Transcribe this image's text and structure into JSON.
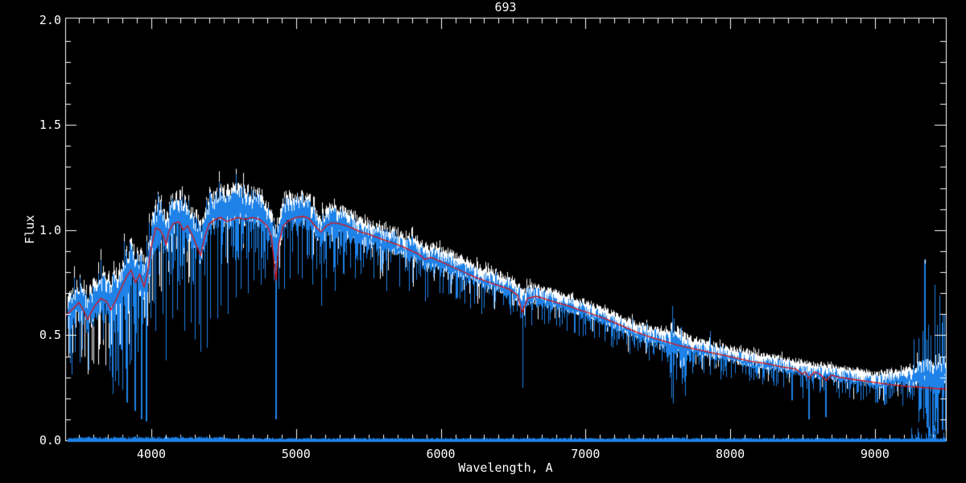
{
  "page": {
    "background_color": "#000000"
  },
  "chart_data": {
    "type": "line",
    "title": "693",
    "xlabel": "Wavelength, A",
    "ylabel": "Flux",
    "xlim": [
      3405,
      9490
    ],
    "ylim": [
      0.0,
      2.0
    ],
    "grid": false,
    "legend": null,
    "background_color": "#000000",
    "axis_color": "#ffffff",
    "x_major_ticks": [
      4000,
      5000,
      6000,
      7000,
      8000,
      9000
    ],
    "x_tick_labels": [
      "4000",
      "5000",
      "6000",
      "7000",
      "8000",
      "9000"
    ],
    "x_minor_step": 100,
    "y_major_ticks": [
      0.0,
      0.5,
      1.0,
      1.5,
      2.0
    ],
    "y_tick_labels": [
      "0.0",
      "0.5",
      "1.0",
      "1.5",
      "2.0"
    ],
    "y_minor_step": 0.1,
    "series": [
      {
        "name": "observed spectrum (white)",
        "type": "noisy-band",
        "color": "#FFFFFF",
        "center_offset": 0.02
      },
      {
        "name": "observed spectrum (blue)",
        "type": "noisy-band",
        "color": "#1E82E8",
        "center_offset": -0.02
      },
      {
        "name": "model fit (red)",
        "type": "line",
        "color": "#DE1212",
        "points": [
          [
            3405,
            0.59
          ],
          [
            3450,
            0.62
          ],
          [
            3500,
            0.655
          ],
          [
            3530,
            0.62
          ],
          [
            3560,
            0.575
          ],
          [
            3600,
            0.63
          ],
          [
            3650,
            0.675
          ],
          [
            3690,
            0.66
          ],
          [
            3720,
            0.62
          ],
          [
            3750,
            0.66
          ],
          [
            3790,
            0.72
          ],
          [
            3830,
            0.78
          ],
          [
            3860,
            0.81
          ],
          [
            3890,
            0.75
          ],
          [
            3920,
            0.79
          ],
          [
            3950,
            0.73
          ],
          [
            3975,
            0.8
          ],
          [
            4000,
            0.92
          ],
          [
            4030,
            1.01
          ],
          [
            4060,
            1.0
          ],
          [
            4085,
            0.97
          ],
          [
            4101,
            0.93
          ],
          [
            4120,
            0.99
          ],
          [
            4150,
            1.03
          ],
          [
            4190,
            1.04
          ],
          [
            4220,
            1.0
          ],
          [
            4250,
            1.02
          ],
          [
            4280,
            0.98
          ],
          [
            4310,
            0.93
          ],
          [
            4340,
            0.88
          ],
          [
            4370,
            0.97
          ],
          [
            4400,
            1.03
          ],
          [
            4440,
            1.05
          ],
          [
            4480,
            1.06
          ],
          [
            4520,
            1.04
          ],
          [
            4560,
            1.05
          ],
          [
            4600,
            1.06
          ],
          [
            4650,
            1.05
          ],
          [
            4700,
            1.06
          ],
          [
            4750,
            1.05
          ],
          [
            4800,
            1.02
          ],
          [
            4830,
            0.97
          ],
          [
            4861,
            0.76
          ],
          [
            4880,
            0.93
          ],
          [
            4910,
            1.02
          ],
          [
            4950,
            1.045
          ],
          [
            5000,
            1.06
          ],
          [
            5050,
            1.065
          ],
          [
            5090,
            1.055
          ],
          [
            5130,
            1.02
          ],
          [
            5172,
            0.99
          ],
          [
            5210,
            1.02
          ],
          [
            5250,
            1.035
          ],
          [
            5300,
            1.03
          ],
          [
            5350,
            1.02
          ],
          [
            5400,
            1.005
          ],
          [
            5450,
            0.99
          ],
          [
            5500,
            0.98
          ],
          [
            5560,
            0.965
          ],
          [
            5620,
            0.95
          ],
          [
            5680,
            0.935
          ],
          [
            5740,
            0.92
          ],
          [
            5800,
            0.9
          ],
          [
            5850,
            0.885
          ],
          [
            5890,
            0.86
          ],
          [
            5930,
            0.87
          ],
          [
            6000,
            0.85
          ],
          [
            6080,
            0.825
          ],
          [
            6160,
            0.8
          ],
          [
            6240,
            0.775
          ],
          [
            6320,
            0.755
          ],
          [
            6400,
            0.735
          ],
          [
            6470,
            0.72
          ],
          [
            6530,
            0.69
          ],
          [
            6563,
            0.61
          ],
          [
            6600,
            0.675
          ],
          [
            6660,
            0.685
          ],
          [
            6730,
            0.67
          ],
          [
            6800,
            0.655
          ],
          [
            6880,
            0.64
          ],
          [
            6960,
            0.62
          ],
          [
            7050,
            0.6
          ],
          [
            7150,
            0.575
          ],
          [
            7250,
            0.545
          ],
          [
            7350,
            0.515
          ],
          [
            7450,
            0.49
          ],
          [
            7550,
            0.47
          ],
          [
            7650,
            0.45
          ],
          [
            7750,
            0.435
          ],
          [
            7850,
            0.42
          ],
          [
            7950,
            0.405
          ],
          [
            8050,
            0.39
          ],
          [
            8150,
            0.375
          ],
          [
            8250,
            0.365
          ],
          [
            8350,
            0.35
          ],
          [
            8450,
            0.34
          ],
          [
            8498,
            0.315
          ],
          [
            8520,
            0.325
          ],
          [
            8542,
            0.295
          ],
          [
            8580,
            0.325
          ],
          [
            8620,
            0.315
          ],
          [
            8662,
            0.285
          ],
          [
            8700,
            0.31
          ],
          [
            8750,
            0.3
          ],
          [
            8850,
            0.29
          ],
          [
            8950,
            0.28
          ],
          [
            9050,
            0.27
          ],
          [
            9150,
            0.262
          ],
          [
            9250,
            0.255
          ],
          [
            9350,
            0.25
          ],
          [
            9430,
            0.246
          ],
          [
            9490,
            0.243
          ]
        ]
      }
    ],
    "band_center": [
      [
        3405,
        0.6
      ],
      [
        3460,
        0.64
      ],
      [
        3510,
        0.67
      ],
      [
        3560,
        0.61
      ],
      [
        3610,
        0.66
      ],
      [
        3660,
        0.71
      ],
      [
        3710,
        0.67
      ],
      [
        3760,
        0.7
      ],
      [
        3810,
        0.77
      ],
      [
        3860,
        0.83
      ],
      [
        3910,
        0.79
      ],
      [
        3960,
        0.77
      ],
      [
        4010,
        0.97
      ],
      [
        4060,
        1.05
      ],
      [
        4101,
        0.97
      ],
      [
        4150,
        1.08
      ],
      [
        4200,
        1.08
      ],
      [
        4250,
        1.05
      ],
      [
        4300,
        0.99
      ],
      [
        4340,
        0.93
      ],
      [
        4390,
        1.07
      ],
      [
        4440,
        1.1
      ],
      [
        4500,
        1.1
      ],
      [
        4560,
        1.11
      ],
      [
        4620,
        1.11
      ],
      [
        4680,
        1.1
      ],
      [
        4740,
        1.1
      ],
      [
        4800,
        1.05
      ],
      [
        4861,
        0.93
      ],
      [
        4920,
        1.08
      ],
      [
        4980,
        1.09
      ],
      [
        5040,
        1.09
      ],
      [
        5100,
        1.07
      ],
      [
        5172,
        1.0
      ],
      [
        5230,
        1.04
      ],
      [
        5290,
        1.03
      ],
      [
        5350,
        1.02
      ],
      [
        5410,
        1.0
      ],
      [
        5470,
        0.99
      ],
      [
        5530,
        0.975
      ],
      [
        5590,
        0.96
      ],
      [
        5650,
        0.945
      ],
      [
        5710,
        0.93
      ],
      [
        5770,
        0.915
      ],
      [
        5830,
        0.9
      ],
      [
        5890,
        0.865
      ],
      [
        5950,
        0.87
      ],
      [
        6020,
        0.855
      ],
      [
        6100,
        0.83
      ],
      [
        6180,
        0.805
      ],
      [
        6260,
        0.78
      ],
      [
        6340,
        0.76
      ],
      [
        6420,
        0.74
      ],
      [
        6500,
        0.72
      ],
      [
        6563,
        0.66
      ],
      [
        6630,
        0.69
      ],
      [
        6700,
        0.675
      ],
      [
        6780,
        0.66
      ],
      [
        6860,
        0.645
      ],
      [
        6940,
        0.63
      ],
      [
        7030,
        0.605
      ],
      [
        7130,
        0.58
      ],
      [
        7230,
        0.55
      ],
      [
        7330,
        0.52
      ],
      [
        7430,
        0.495
      ],
      [
        7530,
        0.475
      ],
      [
        7630,
        0.455
      ],
      [
        7730,
        0.44
      ],
      [
        7830,
        0.425
      ],
      [
        7930,
        0.41
      ],
      [
        8030,
        0.395
      ],
      [
        8130,
        0.38
      ],
      [
        8230,
        0.37
      ],
      [
        8330,
        0.355
      ],
      [
        8430,
        0.345
      ],
      [
        8530,
        0.33
      ],
      [
        8630,
        0.32
      ],
      [
        8730,
        0.31
      ],
      [
        8830,
        0.3
      ],
      [
        8930,
        0.29
      ],
      [
        9000,
        0.275
      ],
      [
        9080,
        0.285
      ],
      [
        9160,
        0.295
      ],
      [
        9240,
        0.3
      ],
      [
        9320,
        0.305
      ],
      [
        9400,
        0.31
      ],
      [
        9490,
        0.315
      ]
    ],
    "band_halfwidth": [
      [
        3405,
        0.07
      ],
      [
        3500,
        0.085
      ],
      [
        3600,
        0.09
      ],
      [
        3700,
        0.095
      ],
      [
        3800,
        0.1
      ],
      [
        3900,
        0.1
      ],
      [
        4000,
        0.095
      ],
      [
        4100,
        0.09
      ],
      [
        4200,
        0.09
      ],
      [
        4300,
        0.09
      ],
      [
        4400,
        0.088
      ],
      [
        4500,
        0.086
      ],
      [
        4600,
        0.084
      ],
      [
        4700,
        0.082
      ],
      [
        4800,
        0.08
      ],
      [
        4900,
        0.075
      ],
      [
        5000,
        0.07
      ],
      [
        5100,
        0.068
      ],
      [
        5200,
        0.065
      ],
      [
        5300,
        0.062
      ],
      [
        5400,
        0.06
      ],
      [
        5500,
        0.057
      ],
      [
        5600,
        0.055
      ],
      [
        5700,
        0.052
      ],
      [
        5800,
        0.05
      ],
      [
        5900,
        0.05
      ],
      [
        6000,
        0.048
      ],
      [
        6100,
        0.046
      ],
      [
        6200,
        0.044
      ],
      [
        6300,
        0.042
      ],
      [
        6400,
        0.04
      ],
      [
        6500,
        0.04
      ],
      [
        6600,
        0.038
      ],
      [
        6700,
        0.036
      ],
      [
        6800,
        0.035
      ],
      [
        6900,
        0.035
      ],
      [
        7000,
        0.034
      ],
      [
        7100,
        0.033
      ],
      [
        7200,
        0.032
      ],
      [
        7300,
        0.032
      ],
      [
        7400,
        0.032
      ],
      [
        7500,
        0.04
      ],
      [
        7570,
        0.055
      ],
      [
        7650,
        0.06
      ],
      [
        7720,
        0.035
      ],
      [
        7800,
        0.03
      ],
      [
        7900,
        0.03
      ],
      [
        8000,
        0.028
      ],
      [
        8100,
        0.028
      ],
      [
        8200,
        0.028
      ],
      [
        8300,
        0.027
      ],
      [
        8400,
        0.027
      ],
      [
        8500,
        0.026
      ],
      [
        8600,
        0.026
      ],
      [
        8700,
        0.026
      ],
      [
        8800,
        0.027
      ],
      [
        8900,
        0.028
      ],
      [
        9000,
        0.03
      ],
      [
        9100,
        0.032
      ],
      [
        9200,
        0.035
      ],
      [
        9300,
        0.05
      ],
      [
        9400,
        0.07
      ],
      [
        9490,
        0.075
      ]
    ],
    "absorption_lines": [
      [
        3712,
        0.33
      ],
      [
        3727,
        0.3
      ],
      [
        3735,
        0.22
      ],
      [
        3750,
        0.28
      ],
      [
        3760,
        0.33
      ],
      [
        3771,
        0.26
      ],
      [
        3798,
        0.24
      ],
      [
        3820,
        0.34
      ],
      [
        3835,
        0.18
      ],
      [
        3850,
        0.36
      ],
      [
        3860,
        0.38
      ],
      [
        3889,
        0.14
      ],
      [
        3905,
        0.42
      ],
      [
        3934,
        0.1
      ],
      [
        3969,
        0.09
      ],
      [
        4026,
        0.52
      ],
      [
        4077,
        0.6
      ],
      [
        4101,
        0.38
      ],
      [
        4144,
        0.58
      ],
      [
        4178,
        0.62
      ],
      [
        4227,
        0.52
      ],
      [
        4271,
        0.56
      ],
      [
        4300,
        0.48
      ],
      [
        4326,
        0.55
      ],
      [
        4340,
        0.42
      ],
      [
        4383,
        0.44
      ],
      [
        4405,
        0.58
      ],
      [
        4455,
        0.58
      ],
      [
        4481,
        0.64
      ],
      [
        4531,
        0.6
      ],
      [
        4584,
        0.68
      ],
      [
        4620,
        0.72
      ],
      [
        4668,
        0.7
      ],
      [
        4704,
        0.76
      ],
      [
        4755,
        0.74
      ],
      [
        4861,
        0.1
      ],
      [
        4920,
        0.72
      ],
      [
        4957,
        0.77
      ],
      [
        5015,
        0.79
      ],
      [
        5041,
        0.77
      ],
      [
        5110,
        0.74
      ],
      [
        5172,
        0.64
      ],
      [
        5205,
        0.77
      ],
      [
        5270,
        0.71
      ],
      [
        5328,
        0.79
      ],
      [
        5405,
        0.77
      ],
      [
        5446,
        0.79
      ],
      [
        5535,
        0.77
      ],
      [
        5625,
        0.71
      ],
      [
        5711,
        0.73
      ],
      [
        5782,
        0.71
      ],
      [
        5890,
        0.66
      ],
      [
        5990,
        0.7
      ],
      [
        6103,
        0.67
      ],
      [
        6165,
        0.65
      ],
      [
        6280,
        0.6
      ],
      [
        6362,
        0.63
      ],
      [
        6495,
        0.61
      ],
      [
        6563,
        0.25
      ],
      [
        6717,
        0.57
      ],
      [
        6869,
        0.52
      ],
      [
        7000,
        0.5
      ],
      [
        7090,
        0.49
      ],
      [
        7186,
        0.44
      ],
      [
        7280,
        0.46
      ],
      [
        7340,
        0.44
      ],
      [
        7470,
        0.41
      ],
      [
        7720,
        0.37
      ],
      [
        7780,
        0.36
      ],
      [
        7860,
        0.33
      ],
      [
        7940,
        0.33
      ],
      [
        8030,
        0.32
      ],
      [
        8130,
        0.31
      ],
      [
        8230,
        0.3
      ],
      [
        8330,
        0.27
      ],
      [
        8430,
        0.19
      ],
      [
        8498,
        0.2
      ],
      [
        8542,
        0.1
      ],
      [
        8620,
        0.25
      ],
      [
        8662,
        0.11
      ],
      [
        8710,
        0.26
      ],
      [
        8750,
        0.2
      ],
      [
        8810,
        0.24
      ],
      [
        8870,
        0.22
      ],
      [
        8940,
        0.21
      ],
      [
        9015,
        0.18
      ],
      [
        9065,
        0.17
      ],
      [
        9120,
        0.21
      ],
      [
        9180,
        0.22
      ],
      [
        9240,
        0.2
      ],
      [
        9310,
        0.15
      ],
      [
        9360,
        0.06
      ],
      [
        9400,
        0.02
      ],
      [
        9435,
        0.03
      ],
      [
        9470,
        0.05
      ]
    ],
    "emission_spikes": [
      [
        7600,
        0.64
      ],
      [
        7612,
        0.58
      ],
      [
        7660,
        0.54
      ],
      [
        7860,
        0.52
      ],
      [
        9270,
        0.48
      ],
      [
        9330,
        0.52
      ],
      [
        9346,
        0.86
      ],
      [
        9368,
        0.55
      ],
      [
        9385,
        0.5
      ],
      [
        9414,
        0.74
      ],
      [
        9428,
        0.55
      ],
      [
        9447,
        0.69
      ],
      [
        9462,
        0.56
      ],
      [
        9480,
        0.6
      ]
    ],
    "error_spectrum": {
      "name": "error spectrum (blue, near zero)",
      "color": "#1E82E8",
      "level": 0.008
    }
  }
}
